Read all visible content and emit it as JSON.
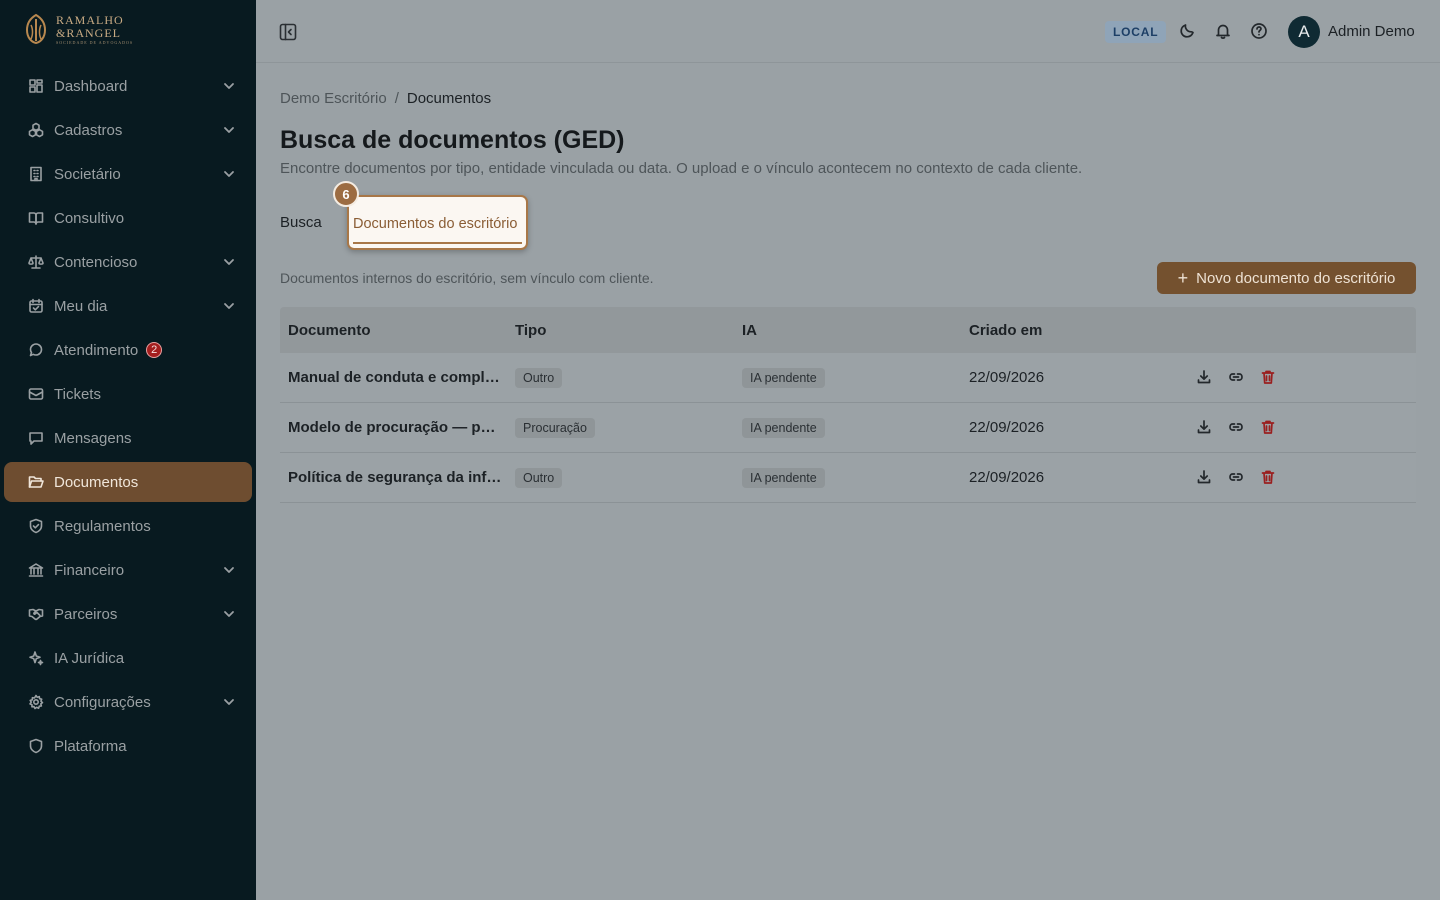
{
  "brand": {
    "line1": "RAMALHO",
    "line2": "&RANGEL",
    "line3": "SOCIEDADE DE ADVOGADOS"
  },
  "sidebar": {
    "items": [
      {
        "label": "Dashboard",
        "icon": "layout-grid-icon",
        "expandable": true
      },
      {
        "label": "Cadastros",
        "icon": "boxes-icon",
        "expandable": true
      },
      {
        "label": "Societário",
        "icon": "building-icon",
        "expandable": true
      },
      {
        "label": "Consultivo",
        "icon": "book-open-icon",
        "expandable": false
      },
      {
        "label": "Contencioso",
        "icon": "scale-icon",
        "expandable": true
      },
      {
        "label": "Meu dia",
        "icon": "calendar-check-icon",
        "expandable": true
      },
      {
        "label": "Atendimento",
        "icon": "message-circle-icon",
        "expandable": false,
        "badge": "2"
      },
      {
        "label": "Tickets",
        "icon": "ticket-icon",
        "expandable": false
      },
      {
        "label": "Mensagens",
        "icon": "message-square-icon",
        "expandable": false
      },
      {
        "label": "Documentos",
        "icon": "folder-open-icon",
        "expandable": false,
        "active": true
      },
      {
        "label": "Regulamentos",
        "icon": "shield-check-icon",
        "expandable": false
      },
      {
        "label": "Financeiro",
        "icon": "landmark-icon",
        "expandable": true
      },
      {
        "label": "Parceiros",
        "icon": "handshake-icon",
        "expandable": true
      },
      {
        "label": "IA Jurídica",
        "icon": "sparkles-icon",
        "expandable": false
      },
      {
        "label": "Configurações",
        "icon": "gear-icon",
        "expandable": true
      },
      {
        "label": "Plataforma",
        "icon": "shield-icon",
        "expandable": false
      }
    ]
  },
  "topbar": {
    "env_badge": "LOCAL",
    "avatar_initial": "A",
    "user_name": "Admin Demo"
  },
  "breadcrumb": {
    "root": "Demo Escritório",
    "separator": "/",
    "current": "Documentos"
  },
  "page": {
    "title": "Busca de documentos (GED)",
    "subtitle": "Encontre documentos por tipo, entidade vinculada ou data. O upload e o vínculo acontecem no contexto de cada cliente."
  },
  "tabs": [
    {
      "label": "Busca"
    },
    {
      "label": "Documentos do escritório",
      "active": true
    }
  ],
  "tour_step": "6",
  "section_note": "Documentos internos do escritório, sem vínculo com cliente.",
  "new_button_label": "Novo documento do escritório",
  "table": {
    "headers": [
      "Documento",
      "Tipo",
      "IA",
      "Criado em",
      ""
    ],
    "rows": [
      {
        "documento": "Manual de conduta e compliance",
        "tipo": "Outro",
        "ia": "IA pendente",
        "criado_em": "22/09/2026"
      },
      {
        "documento": "Modelo de procuração — padrão",
        "tipo": "Procuração",
        "ia": "IA pendente",
        "criado_em": "22/09/2026"
      },
      {
        "documento": "Política de segurança da informação",
        "tipo": "Outro",
        "ia": "IA pendente",
        "criado_em": "22/09/2026"
      }
    ]
  },
  "colors": {
    "sidebar_bg": "#081a20",
    "accent": "#74512f",
    "active_nav": "#6e4d30",
    "danger": "#9a1f1f",
    "env_badge": "#1d3f66"
  }
}
